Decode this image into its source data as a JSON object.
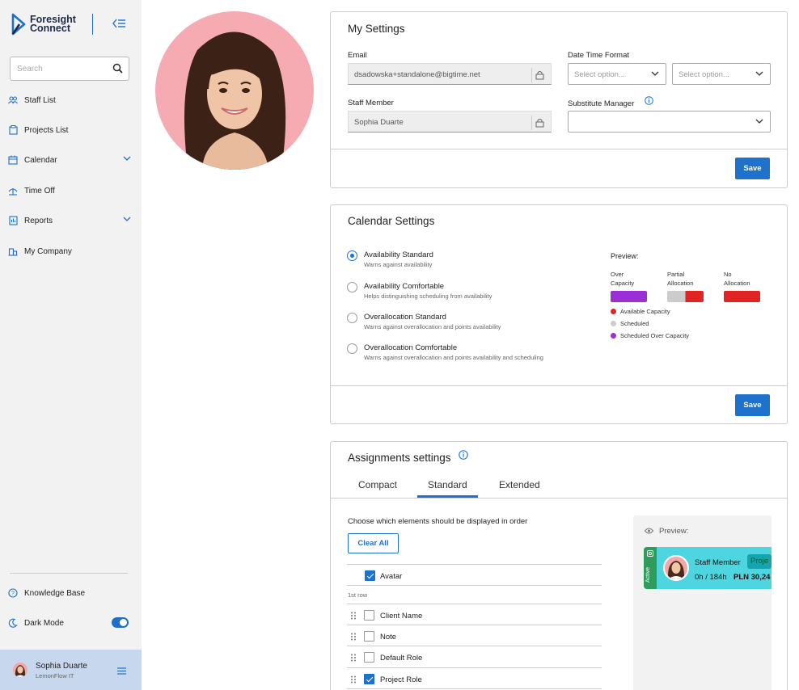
{
  "sidebar": {
    "logo_line1": "Foresight",
    "logo_line2": "Connect",
    "search_placeholder": "Search",
    "items": [
      {
        "label": "Staff List",
        "icon": "users-icon"
      },
      {
        "label": "Projects List",
        "icon": "projects-icon"
      },
      {
        "label": "Calendar",
        "icon": "calendar-icon"
      },
      {
        "label": "Time Off",
        "icon": "time-off-icon"
      },
      {
        "label": "Reports",
        "icon": "reports-icon"
      },
      {
        "label": "My Company",
        "icon": "company-icon"
      }
    ],
    "knowledge_base": "Knowledge Base",
    "dark_mode": "Dark Mode",
    "dark_mode_on": true,
    "user_name": "Sophia Duarte",
    "user_org": "LemonFlow IT"
  },
  "my_settings": {
    "title": "My Settings",
    "email_label": "Email",
    "email_value": "dsadowska+standalone@bigtime.net",
    "staff_label": "Staff Member",
    "staff_value": "Sophia Duarte",
    "dtf_label": "Date Time Format",
    "dtf_placeholder_1": "Select option...",
    "dtf_placeholder_2": "Select option...",
    "sub_label": "Substitute Manager",
    "save": "Save"
  },
  "calendar_settings": {
    "title": "Calendar Settings",
    "options": [
      {
        "label": "Availability Standard",
        "desc": "Warns against availability",
        "checked": true
      },
      {
        "label": "Availability Comfortable",
        "desc": "Helps distinguishing scheduling from availability",
        "checked": false
      },
      {
        "label": "Overallocation Standard",
        "desc": "Warns against overallocation and points availability",
        "checked": false
      },
      {
        "label": "Overallocation Comfortable",
        "desc": "Warns against overallocation and points availability and scheduling",
        "checked": false
      }
    ],
    "preview_title": "Preview:",
    "over_capacity_1": "Over",
    "over_capacity_2": "Capacity",
    "partial_1": "Partial",
    "partial_2": "Allocation",
    "no_alloc_1": "No",
    "no_alloc_2": "Allocation",
    "legend": [
      "Available Capacity",
      "Scheduled",
      "Scheduled Over Capacity"
    ],
    "colors": {
      "purple": "#9b2fd6",
      "gray": "#cccccc",
      "red": "#e02424",
      "blue": "#1f72cc"
    },
    "save": "Save"
  },
  "assignments": {
    "title": "Assignments settings",
    "tabs": [
      "Compact",
      "Standard",
      "Extended"
    ],
    "active_tab": "Standard",
    "instruction": "Choose which elements should be displayed in order",
    "clear_all": "Clear All",
    "avatar_label": "Avatar",
    "first_row": "1st row",
    "rows": [
      {
        "label": "Client Name",
        "checked": false
      },
      {
        "label": "Note",
        "checked": false
      },
      {
        "label": "Default Role",
        "checked": false
      },
      {
        "label": "Project Role",
        "checked": true
      }
    ],
    "preview_title": "Preview:",
    "pp_status": "Active",
    "pp_name": "Staff Member",
    "pp_badge": "Proje",
    "pp_hours": "0h / 184h",
    "pp_pln": "PLN 30,24"
  }
}
